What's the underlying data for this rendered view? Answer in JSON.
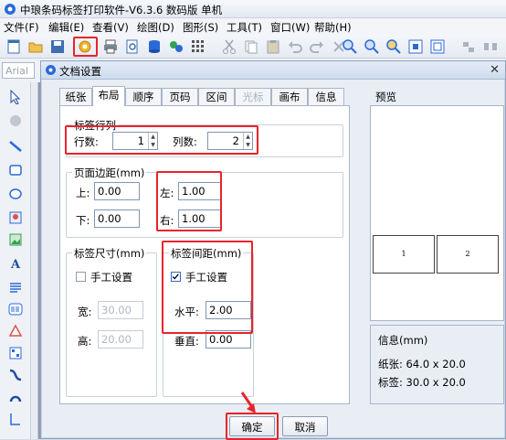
{
  "app": {
    "title": "中琅条码标签打印软件-V6.3.6 数码版 单机",
    "menu": [
      "文件(F)",
      "编辑(E)",
      "查看(V)",
      "绘图(D)",
      "图形(S)",
      "工具(T)",
      "窗口(W)",
      "帮助(H)"
    ],
    "font_box": "Arial"
  },
  "dialog": {
    "title": "文档设置",
    "close": "✕",
    "tabs": [
      {
        "label": "纸张",
        "state": "normal"
      },
      {
        "label": "布局",
        "state": "active"
      },
      {
        "label": "顺序",
        "state": "normal"
      },
      {
        "label": "页码",
        "state": "normal"
      },
      {
        "label": "区间",
        "state": "normal"
      },
      {
        "label": "光标",
        "state": "disabled"
      },
      {
        "label": "画布",
        "state": "normal"
      },
      {
        "label": "信息",
        "state": "normal"
      }
    ],
    "label_rows_cols": {
      "legend": "标签行列",
      "rows_label": "行数:",
      "rows_value": "1",
      "cols_label": "列数:",
      "cols_value": "2"
    },
    "page_margins": {
      "legend": "页面边距(mm)",
      "top_label": "上:",
      "top_value": "0.00",
      "bottom_label": "下:",
      "bottom_value": "0.00",
      "left_label": "左:",
      "left_value": "1.00",
      "right_label": "右:",
      "right_value": "1.00"
    },
    "label_size": {
      "legend": "标签尺寸(mm)",
      "manual_label": "手工设置",
      "manual_checked": false,
      "width_label": "宽:",
      "width_value": "30.00",
      "height_label": "高:",
      "height_value": "20.00"
    },
    "label_spacing": {
      "legend": "标签间距(mm)",
      "manual_label": "手工设置",
      "manual_checked": true,
      "horizontal_label": "水平:",
      "horizontal_value": "2.00",
      "vertical_label": "垂直:",
      "vertical_value": "0.00"
    },
    "preview": {
      "label": "预览",
      "cells": [
        "1",
        "2"
      ]
    },
    "info": {
      "title": "信息(mm)",
      "paper": "纸张: 64.0 x 20.0",
      "label": "标签: 30.0 x 20.0"
    },
    "buttons": {
      "ok": "确定",
      "cancel": "取消"
    }
  },
  "colors": {
    "highlight": "#e8242a",
    "accent": "#2a6ad8"
  }
}
